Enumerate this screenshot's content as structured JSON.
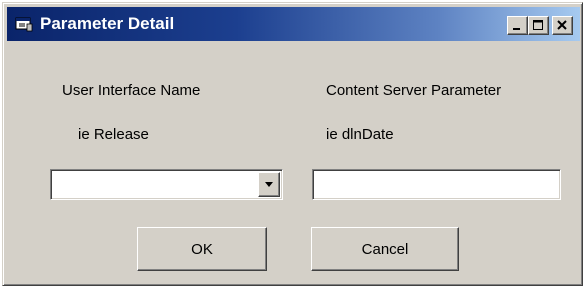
{
  "window": {
    "title": "Parameter Detail",
    "icon": "dialog-app-icon",
    "controls": [
      "minimize-icon",
      "maximize-icon",
      "close-icon"
    ]
  },
  "left_column": {
    "heading": "User Interface Name",
    "example": "ie Release",
    "combo_value": ""
  },
  "right_column": {
    "heading": "Content Server Parameter",
    "example": "ie dlnDate",
    "text_value": ""
  },
  "buttons": {
    "ok_label": "OK",
    "cancel_label": "Cancel"
  },
  "colors": {
    "titlebar_start": "#0a246a",
    "titlebar_end": "#a6caf0",
    "face": "#d4d0c8"
  }
}
